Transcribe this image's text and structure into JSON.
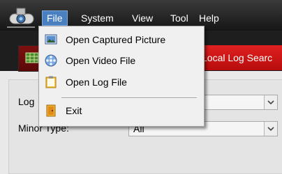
{
  "menubar": {
    "items": [
      {
        "label": "File",
        "active": true
      },
      {
        "label": "System"
      },
      {
        "label": "View"
      },
      {
        "label": "Tool"
      },
      {
        "label": "Help"
      }
    ],
    "logo_icon": "camera-icon"
  },
  "toolbar": {
    "local_log_search": "Local Log Searc"
  },
  "filters": {
    "major_type_label": "Log",
    "major_type_value": "",
    "minor_type_label": "Minor Type:",
    "minor_type_value": "All"
  },
  "file_menu": {
    "items": [
      {
        "label": "Open Captured Picture",
        "icon": "picture-icon"
      },
      {
        "label": "Open Video File",
        "icon": "film-reel-icon"
      },
      {
        "label": "Open Log File",
        "icon": "clipboard-icon"
      },
      {
        "label": "Exit",
        "icon": "exit-door-icon"
      }
    ]
  },
  "colors": {
    "menu_highlight": "#4a7fc0",
    "local_log_tab": "#d51515",
    "menubar_bg": "#1e1e1e"
  }
}
